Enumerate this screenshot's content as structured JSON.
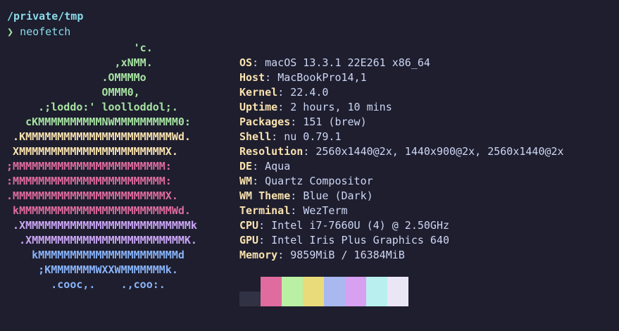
{
  "cwd": "/private/tmp",
  "prompt": {
    "symbol": "❯",
    "command": "neofetch"
  },
  "logo": [
    {
      "text": "                     'c.",
      "color": "#a6e3a1"
    },
    {
      "text": "                  ,xNMM.",
      "color": "#a6e3a1"
    },
    {
      "text": "                .OMMMMo",
      "color": "#a6e3a1"
    },
    {
      "text": "                OMMM0,",
      "color": "#a6e3a1"
    },
    {
      "text": "      .;loddo:' loolloddol;.",
      "color": "#a6e3a1"
    },
    {
      "text": "    cKMMMMMMMMMMNWMMMMMMMMMM0:",
      "color": "#a6e3a1"
    },
    {
      "text": "  .KMMMMMMMMMMMMMMMMMMMMMMMWd.",
      "color": "#f9e2af"
    },
    {
      "text": "  XMMMMMMMMMMMMMMMMMMMMMMMX.",
      "color": "#f9e2af"
    },
    {
      "text": " ;MMMMMMMMMMMMMMMMMMMMMMMM:",
      "color": "#e06c9f"
    },
    {
      "text": " :MMMMMMMMMMMMMMMMMMMMMMMM:",
      "color": "#e06c9f"
    },
    {
      "text": " .MMMMMMMMMMMMMMMMMMMMMMMMX.",
      "color": "#e06c9f"
    },
    {
      "text": "  kMMMMMMMMMMMMMMMMMMMMMMMMWd.",
      "color": "#e06c9f"
    },
    {
      "text": "  .XMMMMMMMMMMMMMMMMMMMMMMMMMMk",
      "color": "#cba6f7"
    },
    {
      "text": "   .XMMMMMMMMMMMMMMMMMMMMMMMMK.",
      "color": "#cba6f7"
    },
    {
      "text": "     kMMMMMMMMMMMMMMMMMMMMMMd",
      "color": "#89b4fa"
    },
    {
      "text": "      ;KMMMMMMMWXXWMMMMMMMk.",
      "color": "#89b4fa"
    },
    {
      "text": "        .cooc,.    .,coo:.",
      "color": "#89b4fa"
    }
  ],
  "info": [
    {
      "key": "OS",
      "value": "macOS 13.3.1 22E261 x86_64"
    },
    {
      "key": "Host",
      "value": "MacBookPro14,1"
    },
    {
      "key": "Kernel",
      "value": "22.4.0"
    },
    {
      "key": "Uptime",
      "value": "2 hours, 10 mins"
    },
    {
      "key": "Packages",
      "value": "151 (brew)"
    },
    {
      "key": "Shell",
      "value": "nu 0.79.1"
    },
    {
      "key": "Resolution",
      "value": "2560x1440@2x, 1440x900@2x, 2560x1440@2x"
    },
    {
      "key": "DE",
      "value": "Aqua"
    },
    {
      "key": "WM",
      "value": "Quartz Compositor"
    },
    {
      "key": "WM Theme",
      "value": "Blue (Dark)"
    },
    {
      "key": "Terminal",
      "value": "WezTerm"
    },
    {
      "key": "CPU",
      "value": "Intel i7-7660U (4) @ 2.50GHz"
    },
    {
      "key": "GPU",
      "value": "Intel Iris Plus Graphics 640"
    },
    {
      "key": "Memory",
      "value": "9859MiB / 16384MiB"
    }
  ],
  "palette": [
    "#313244",
    "#e06c9f",
    "#b9f0a4",
    "#eadb7a",
    "#a9b9f0",
    "#d7a0f0",
    "#b9f0ef",
    "#ebe6f6"
  ]
}
